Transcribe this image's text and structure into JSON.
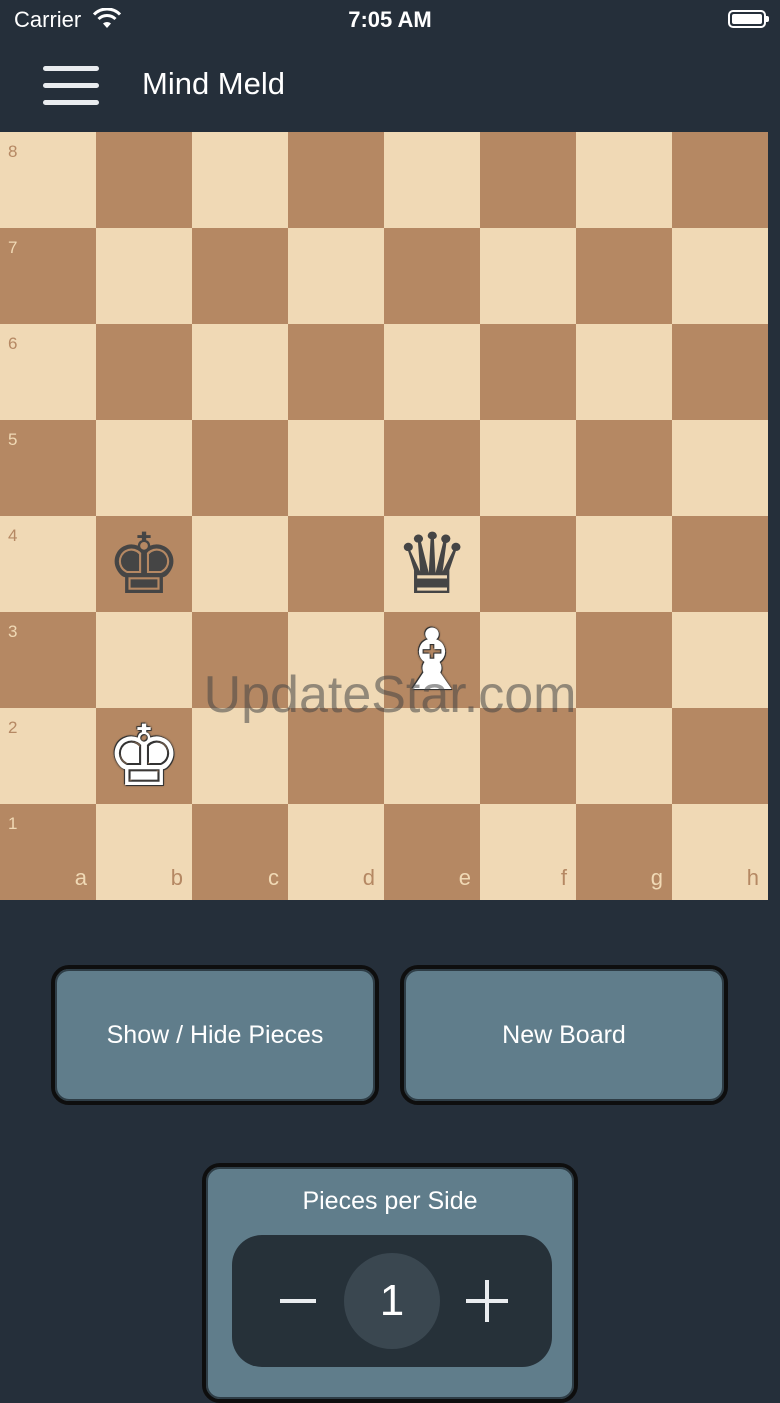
{
  "status_bar": {
    "carrier": "Carrier",
    "time": "7:05 AM"
  },
  "nav": {
    "title": "Mind Meld",
    "menu_icon": "hamburger-menu-icon"
  },
  "board": {
    "ranks": [
      "8",
      "7",
      "6",
      "5",
      "4",
      "3",
      "2",
      "1"
    ],
    "files": [
      "a",
      "b",
      "c",
      "d",
      "e",
      "f",
      "g",
      "h"
    ],
    "pieces": [
      {
        "square": "b4",
        "color": "black",
        "type": "king",
        "glyph": "♚"
      },
      {
        "square": "e4",
        "color": "black",
        "type": "queen",
        "glyph": "♛"
      },
      {
        "square": "e3",
        "color": "white",
        "type": "bishop",
        "glyph": "♝"
      },
      {
        "square": "b2",
        "color": "white",
        "type": "king",
        "glyph": "♚"
      }
    ],
    "colors": {
      "light": "#f0d9b5",
      "dark": "#b58863"
    }
  },
  "watermark": "UpdateStar.com",
  "controls": {
    "show_hide_label": "Show / Hide Pieces",
    "new_board_label": "New Board",
    "pieces_per_side_label": "Pieces per Side",
    "pieces_per_side_value": "1"
  }
}
